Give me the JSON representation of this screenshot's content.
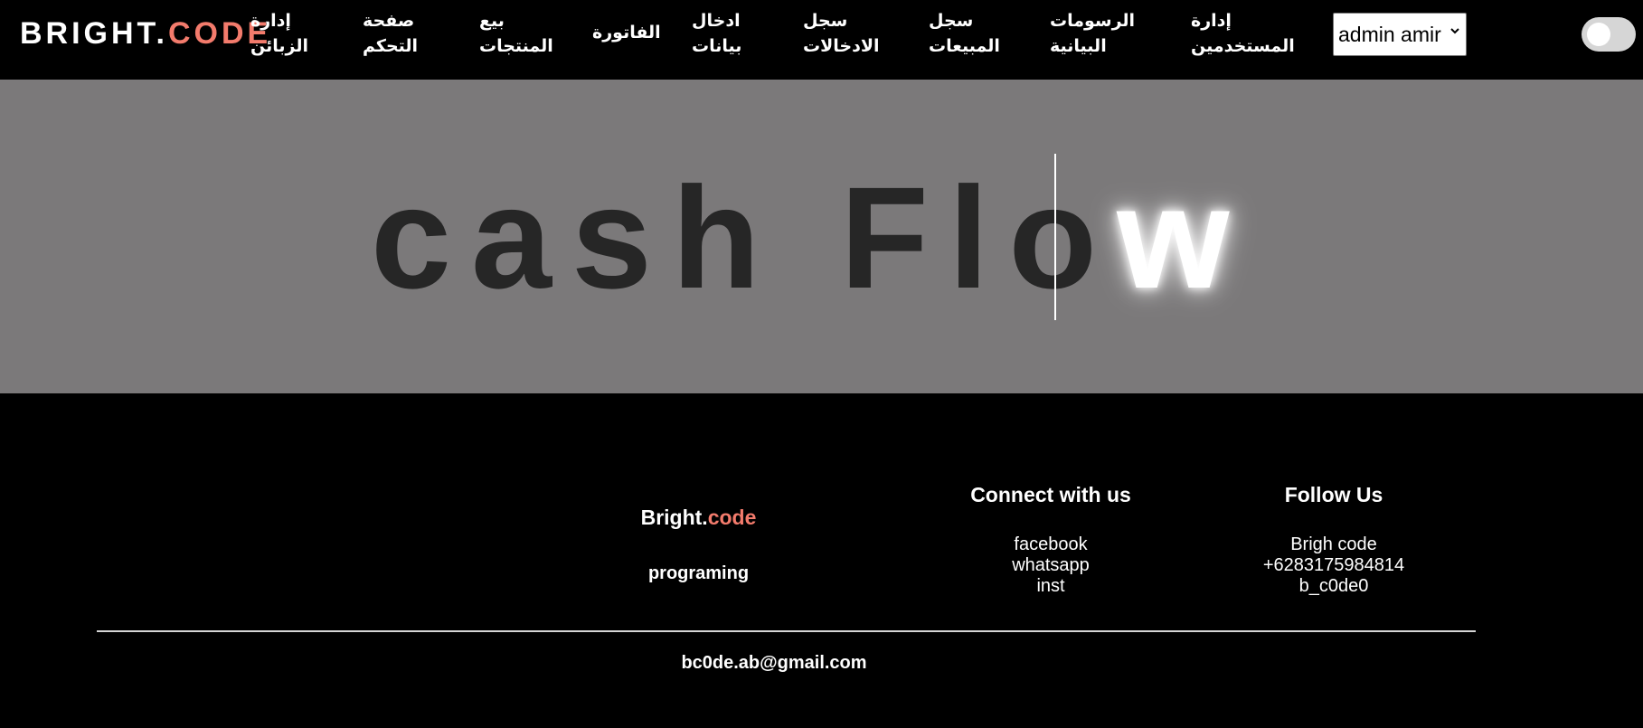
{
  "navbar": {
    "logo": {
      "main": "BRIGHT.",
      "accent": "CODE"
    },
    "items": [
      {
        "line1": "إدارة",
        "line2": "الزبائن"
      },
      {
        "line1": "صفحة",
        "line2": "التحكم"
      },
      {
        "line1": "بيع",
        "line2": "المنتجات"
      },
      {
        "line1": "الفاتورة",
        "line2": ""
      },
      {
        "line1": "ادخال",
        "line2": "بيانات"
      },
      {
        "line1": "سجل",
        "line2": "الادخالات"
      },
      {
        "line1": "سجل",
        "line2": "المبيعات"
      },
      {
        "line1": "الرسومات",
        "line2": "البيانية"
      },
      {
        "line1": "إدارة",
        "line2": "المستخدمين"
      }
    ],
    "user_select": {
      "selected": "admin amir"
    },
    "theme_toggle": {
      "state": "off"
    }
  },
  "hero": {
    "text_main": "cash Flo",
    "text_glow": "w"
  },
  "footer": {
    "brand": {
      "main": "Bright.",
      "accent": "code",
      "tagline": "programing"
    },
    "connect": {
      "title": "Connect with us",
      "links": [
        "facebook",
        "whatsapp",
        "inst"
      ]
    },
    "follow": {
      "title": "Follow Us",
      "links": [
        "Brigh code",
        "+6283175984814",
        "b_c0de0"
      ]
    },
    "email": "bc0de.ab@gmail.com"
  },
  "colors": {
    "accent": "#f37b6c",
    "hero_bg": "#7b797a",
    "hero_text": "#262626",
    "background": "#000000"
  }
}
